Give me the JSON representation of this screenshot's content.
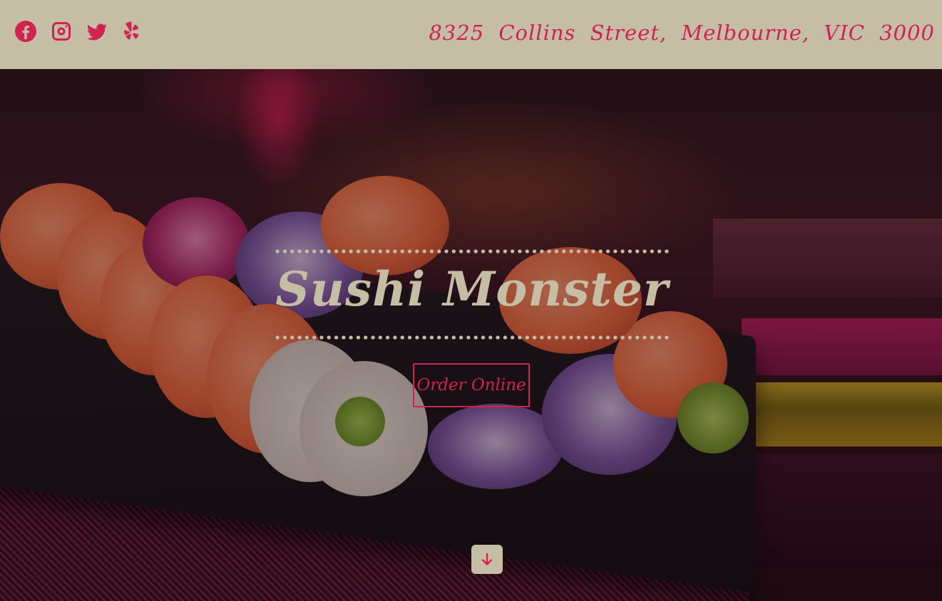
{
  "header": {
    "social_icons": [
      "facebook-icon",
      "instagram-icon",
      "twitter-icon",
      "yelp-icon"
    ],
    "address": "8325 Collins Street, Melbourne, VIC 3000"
  },
  "hero": {
    "title": "Sushi Monster",
    "cta_label": "Order Online",
    "scroll_icon": "arrow-down-icon"
  },
  "colors": {
    "accent": "#d0234f",
    "header_bg": "#c6bda5",
    "title_color": "#c6bda5"
  }
}
